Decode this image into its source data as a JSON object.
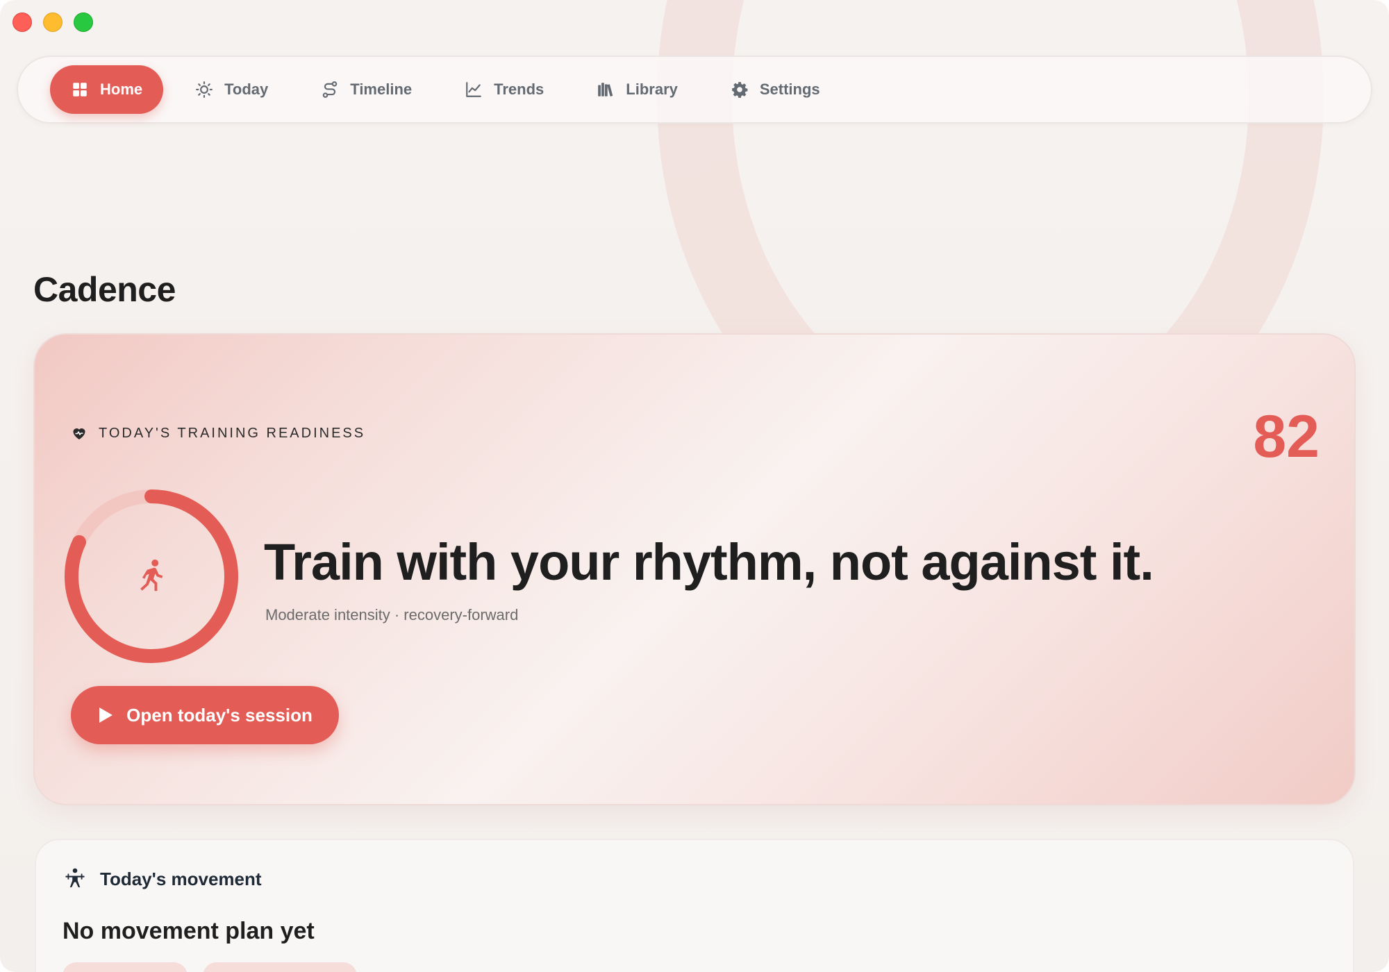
{
  "nav": {
    "items": [
      {
        "label": "Home",
        "icon": "grid-icon",
        "active": true
      },
      {
        "label": "Today",
        "icon": "sun-icon",
        "active": false
      },
      {
        "label": "Timeline",
        "icon": "route-icon",
        "active": false
      },
      {
        "label": "Trends",
        "icon": "line-chart-icon",
        "active": false
      },
      {
        "label": "Library",
        "icon": "books-icon",
        "active": false
      },
      {
        "label": "Settings",
        "icon": "gear-icon",
        "active": false
      }
    ]
  },
  "page": {
    "title": "Cadence"
  },
  "readiness": {
    "kicker": "TODAY'S TRAINING READINESS",
    "score": "82",
    "score_fraction": 0.82,
    "headline": "Train with your rhythm, not against it.",
    "subline": "Moderate intensity · recovery-forward",
    "cta_label": "Open today's session"
  },
  "movement": {
    "title": "Today's movement",
    "empty_title": "No movement plan yet"
  },
  "colors": {
    "accent": "#e35c55",
    "background": "#f6f2f0"
  }
}
